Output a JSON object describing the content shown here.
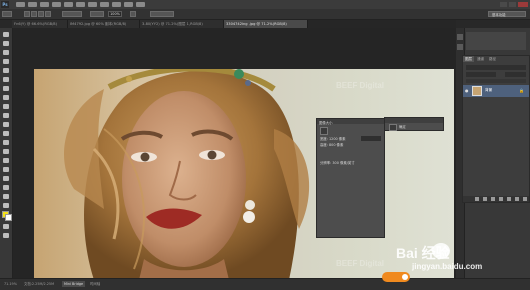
{
  "menubar": {
    "left_badge": "Ps",
    "right_label": "基本功能"
  },
  "options": {
    "zoom_value": "100%"
  },
  "tabs": [
    {
      "label": "Fn6(Y) @ 66.6%(RGB/8)"
    },
    {
      "label": "IM4792.jpg @ 60% 副本(RGB/8)"
    },
    {
      "label": "3-80(YY2) @ 71.2%(图层 1,RGB/8)"
    },
    {
      "label": "3304742ing .jpg @ 71.2%(RGB/8)"
    }
  ],
  "panels": {
    "tabs": [
      "图层",
      "通道",
      "路径"
    ],
    "layer_name": "背景",
    "lock_symbol": "🔒"
  },
  "dialog_main": {
    "title": "图像大小",
    "row1": "宽度: 1200 像素",
    "row2": "高度: 800 像素",
    "footer": "分辨率: 300 像素/英寸"
  },
  "dialog_small": {
    "label": "确定"
  },
  "watermarks": {
    "beef_text": "BEEF Digital",
    "baidu_cn": "Bai 经验",
    "baidu_url": "jingyan.baidu.com"
  },
  "statusbar": {
    "zoom": "71.19%",
    "doc": "文档:2.25M/2.25M",
    "tabs": [
      "Mini Bridge",
      "时间轴"
    ]
  }
}
